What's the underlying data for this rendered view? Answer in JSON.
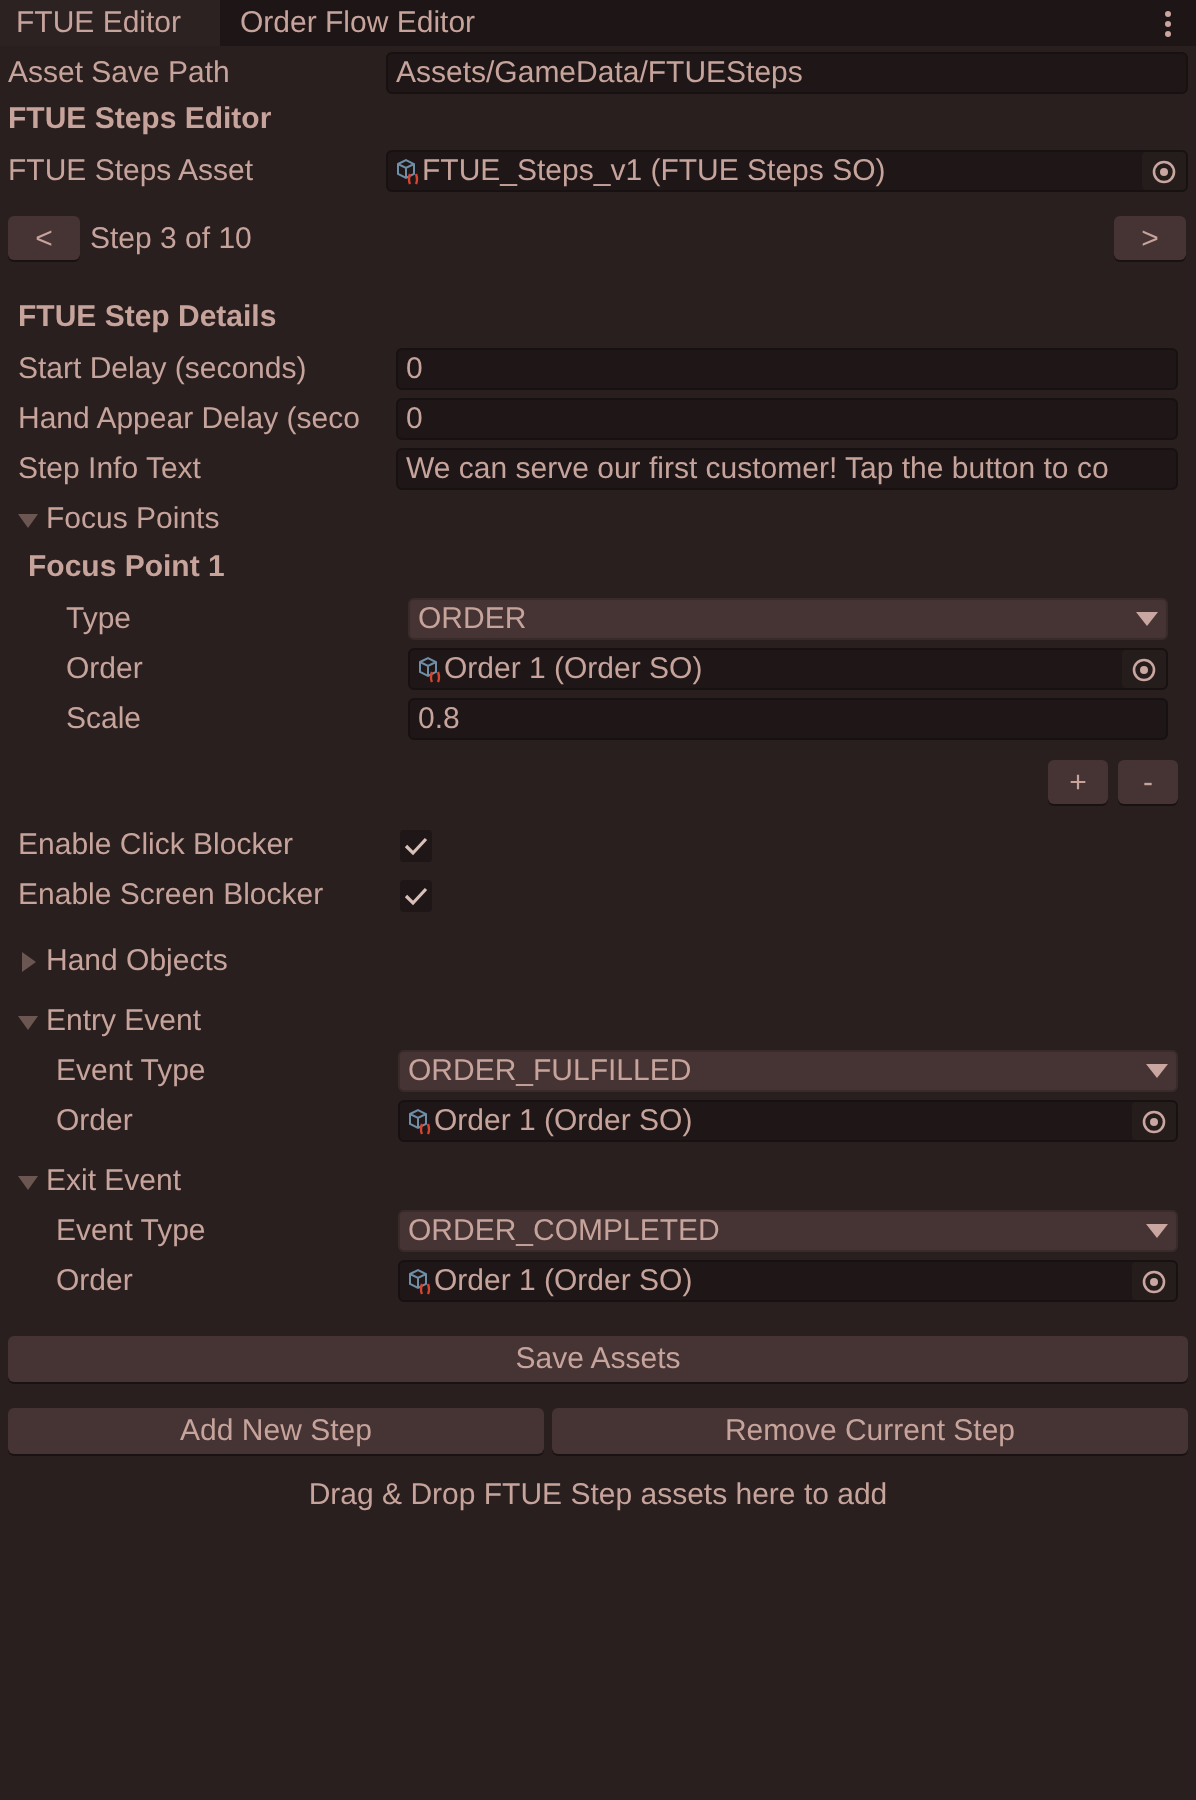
{
  "tabs": [
    {
      "label": "FTUE Editor",
      "selected": true
    },
    {
      "label": "Order Flow Editor",
      "selected": false
    }
  ],
  "asset_save_path": {
    "label": "Asset Save Path",
    "value": "Assets/GameData/FTUESteps"
  },
  "editor_title": "FTUE Steps Editor",
  "steps_asset": {
    "label": "FTUE Steps Asset",
    "value": "FTUE_Steps_v1 (FTUE Steps SO)"
  },
  "step_nav": {
    "prev": "<",
    "label": "Step 3 of 10",
    "next": ">"
  },
  "details": {
    "title": "FTUE Step Details",
    "fields": [
      {
        "label": "Start Delay (seconds)",
        "value": "0"
      },
      {
        "label": "Hand Appear Delay (seco",
        "value": "0"
      },
      {
        "label": "Step Info Text",
        "value": "We can serve our first customer! Tap the button to co"
      }
    ],
    "focus_points": {
      "label": "Focus Points",
      "expanded": true,
      "items": [
        {
          "title": "Focus Point 1",
          "fields": [
            {
              "label": "Type",
              "kind": "dropdown",
              "value": "ORDER"
            },
            {
              "label": "Order",
              "kind": "object",
              "value": "Order 1 (Order SO)"
            },
            {
              "label": "Scale",
              "kind": "text",
              "value": "0.8"
            }
          ]
        }
      ],
      "add": "+",
      "remove": "-"
    },
    "toggles": [
      {
        "label": "Enable Click Blocker",
        "checked": true
      },
      {
        "label": "Enable Screen Blocker",
        "checked": true
      }
    ],
    "foldouts": [
      {
        "label": "Hand Objects",
        "expanded": false
      },
      {
        "label": "Entry Event",
        "expanded": true,
        "fields": [
          {
            "label": "Event Type",
            "kind": "dropdown",
            "value": "ORDER_FULFILLED"
          },
          {
            "label": "Order",
            "kind": "object",
            "value": "Order 1 (Order SO)"
          }
        ]
      },
      {
        "label": "Exit Event",
        "expanded": true,
        "fields": [
          {
            "label": "Event Type",
            "kind": "dropdown",
            "value": "ORDER_COMPLETED"
          },
          {
            "label": "Order",
            "kind": "object",
            "value": "Order 1 (Order SO)"
          }
        ]
      }
    ]
  },
  "save_button": "Save Assets",
  "add_button": "Add New Step",
  "remove_button": "Remove Current Step",
  "drop_hint": "Drag & Drop FTUE Step assets here to add"
}
